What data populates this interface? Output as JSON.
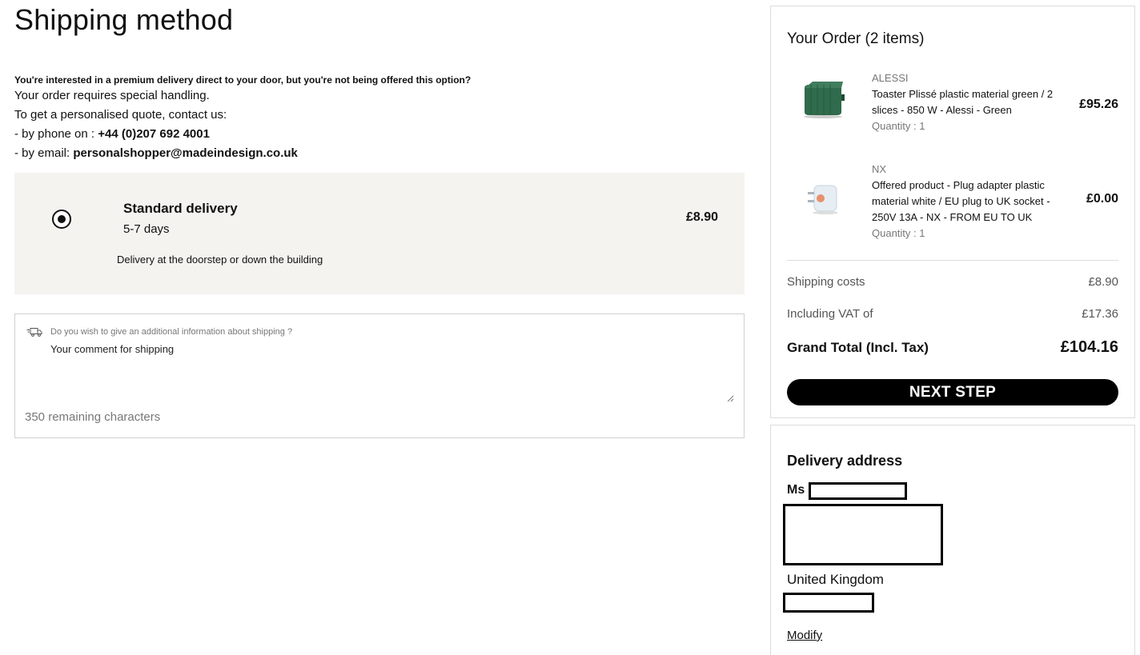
{
  "page": {
    "title": "Shipping method"
  },
  "intro": {
    "question": "You're interested in a premium delivery direct to your door, but you're not being offered this option?",
    "line1": "Your order requires special handling.",
    "line2": "To get a personalised quote, contact us:",
    "phone_prefix": "- by phone on : ",
    "phone": "+44 (0)207 692 4001",
    "email_prefix": "- by email: ",
    "email": "personalshopper@madeindesign.co.uk"
  },
  "shipping_option": {
    "name": "Standard delivery",
    "days": "5-7 days",
    "price": "£8.90",
    "description": "Delivery at the doorstep or down the building",
    "selected": true
  },
  "comment": {
    "question": "Do you wish to give an additional information about shipping ?",
    "placeholder": "Your comment for shipping",
    "remaining": "350 remaining characters",
    "icon": "truck-icon"
  },
  "order": {
    "title": "Your Order (2 items)",
    "items": [
      {
        "brand": "ALESSI",
        "name": "Toaster Plissé plastic material green / 2 slices - 850 W - Alessi - Green",
        "quantity": "Quantity : 1",
        "price": "£95.26"
      },
      {
        "brand": "NX",
        "name": "Offered product - Plug adapter plastic material white / EU plug to UK socket - 250V 13A - NX - FROM EU TO UK",
        "quantity": "Quantity : 1",
        "price": "£0.00"
      }
    ],
    "shipping_label": "Shipping costs",
    "shipping_value": "£8.90",
    "vat_label": "Including VAT of",
    "vat_value": "£17.36",
    "total_label": "Grand Total (Incl. Tax)",
    "total_value": "£104.16",
    "next_button": "NEXT STEP"
  },
  "address": {
    "title": "Delivery address",
    "salutation": "Ms",
    "country": "United Kingdom",
    "modify": "Modify"
  },
  "colors": {
    "option_background": "#f4f3ef",
    "button": "#000000",
    "toaster_green": "#2f6b4c"
  }
}
